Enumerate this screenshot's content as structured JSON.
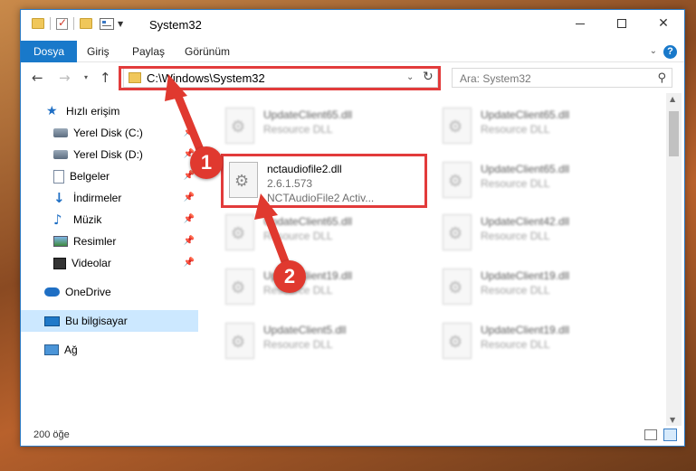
{
  "window": {
    "title": "System32",
    "min_glyph": "",
    "close_glyph": "✕"
  },
  "ribbon": {
    "tabs": [
      "Dosya",
      "Giriş",
      "Paylaş",
      "Görünüm"
    ],
    "help": "?"
  },
  "nav": {
    "back": "←",
    "forward": "→",
    "recent": "▾",
    "up": "↑",
    "address": "C:\\Windows\\System32",
    "address_drop": "⌄",
    "refresh": "↻",
    "search_placeholder": "Ara: System32",
    "search_glyph": "⌕"
  },
  "sidebar": {
    "quick_access": "Hızlı erişim",
    "items": [
      {
        "label": "Yerel Disk (C:)",
        "icon": "drive-icon",
        "pinned": true
      },
      {
        "label": "Yerel Disk (D:)",
        "icon": "drive-icon",
        "pinned": true
      },
      {
        "label": "Belgeler",
        "icon": "documents-icon",
        "pinned": true
      },
      {
        "label": "İndirmeler",
        "icon": "downloads-icon",
        "pinned": true
      },
      {
        "label": "Müzik",
        "icon": "music-icon",
        "pinned": true
      },
      {
        "label": "Resimler",
        "icon": "pictures-icon",
        "pinned": true
      },
      {
        "label": "Videolar",
        "icon": "videos-icon",
        "pinned": true
      }
    ],
    "onedrive": "OneDrive",
    "this_pc": "Bu bilgisayar",
    "network": "Ağ",
    "pin_glyph": "📌"
  },
  "files": {
    "highlighted": {
      "name": "nctaudiofile2.dll",
      "version": "2.6.1.573",
      "description": "NCTAudioFile2 Activ..."
    },
    "blurred": [
      {
        "name": "UpdateClient65.dll",
        "type": "Resource DLL"
      },
      {
        "name": "UpdateClient65.dll",
        "type": "Resource DLL"
      },
      {
        "name": "UpdateClient65.dll",
        "type": ""
      },
      {
        "name": "UpdateClient65.dll",
        "type": "Resource DLL"
      },
      {
        "name": "UpdateClient65.dll",
        "type": "Resource DLL"
      },
      {
        "name": "UpdateClient42.dll",
        "type": "Resource DLL"
      },
      {
        "name": "UpdateClient19.dll",
        "type": "Resource DLL"
      },
      {
        "name": "UpdateClient19.dll",
        "type": "Resource DLL"
      },
      {
        "name": "UpdateClient5.dll",
        "type": "Resource DLL"
      },
      {
        "name": "UpdateClient19.dll",
        "type": "Resource DLL"
      }
    ]
  },
  "status": {
    "count": "200 öğe"
  },
  "annotations": {
    "step1": "1",
    "step2": "2",
    "color": "#e0392f"
  }
}
